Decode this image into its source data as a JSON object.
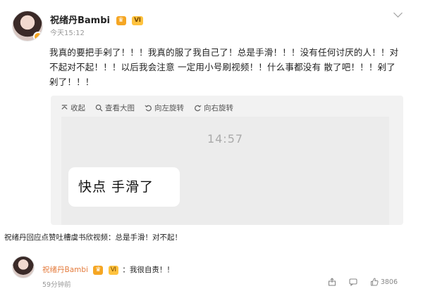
{
  "post": {
    "username": "祝绪丹Bambi",
    "timestamp": "今天15:12",
    "text": "我真的要把手剁了！！！我真的服了我自己了！总是手滑！！！没有任何讨厌的人！！对不起对不起！！！以后我会注意 一定用小号刷视频！！什么事都没有 散了吧！！！剁了剁了！！！",
    "toolbar": {
      "collapse": "收起",
      "view_large": "查看大图",
      "rotate_left": "向左旋转",
      "rotate_right": "向右旋转"
    },
    "image": {
      "time": "14:57",
      "bubble_text": "快点 手滑了"
    }
  },
  "caption": "祝绪丹回应点赞吐槽虞书欣视频：总是手滑！对不起！",
  "reply": {
    "username": "祝绪丹Bambi",
    "text": "：我很自责！！",
    "time": "59分钟前",
    "like_count": "3806"
  },
  "colors": {
    "reply_name": "#e47b3c",
    "badge": "#f5a623"
  }
}
